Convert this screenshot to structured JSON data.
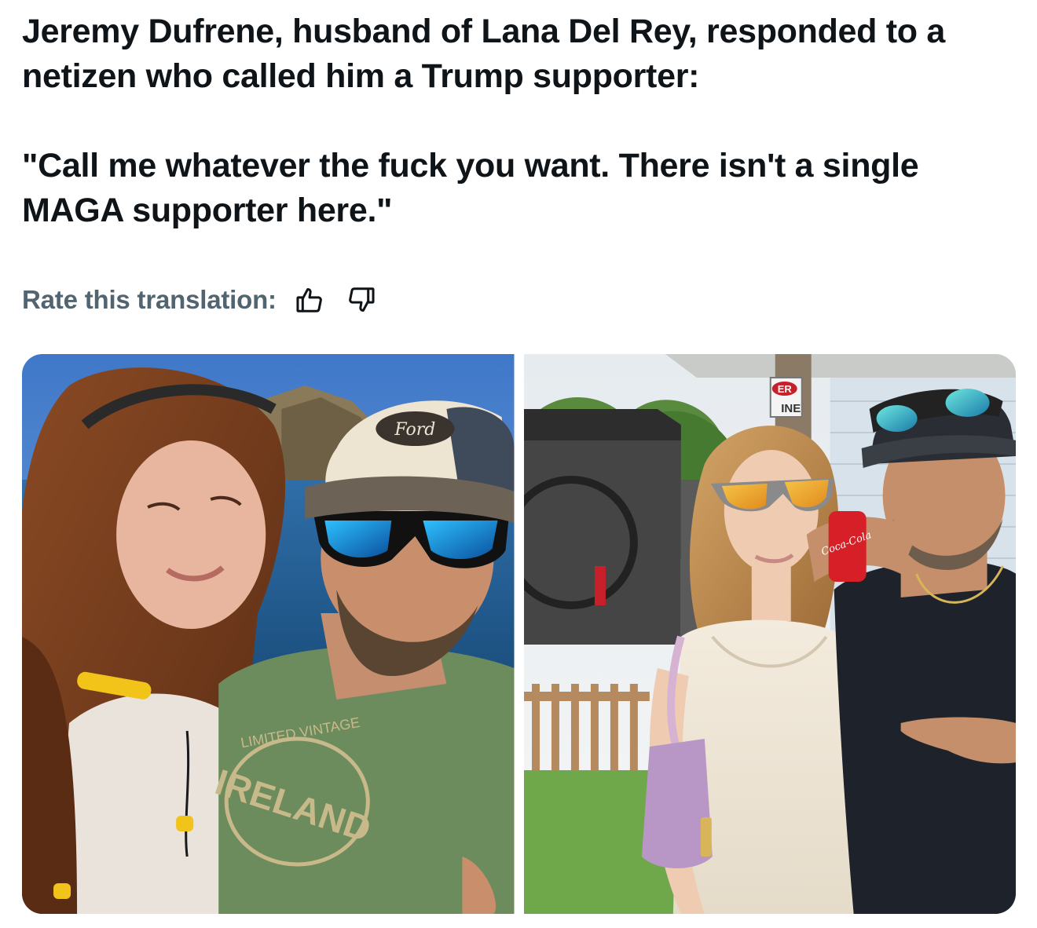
{
  "post": {
    "line_1": "Jeremy Dufrene, husband of Lana Del Rey, responded to a netizen who called him a Trump supporter:",
    "line_2": "\"Call me whatever the fuck you want. There isn't a single MAGA supporter here.\""
  },
  "translation": {
    "rate_label": "Rate this translation:",
    "thumbs_up_icon": "thumbs-up-icon",
    "thumbs_down_icon": "thumbs-down-icon"
  },
  "media": {
    "photo_1": {
      "cap_text": "Ford",
      "shirt_text": "IRELAND",
      "shirt_subtext": "LIMITED VINTAGE"
    },
    "photo_2": {
      "sign_text_1": "ER",
      "sign_text_2": "INE",
      "can_text": "Coca-Cola"
    }
  },
  "colors": {
    "text_primary": "#0f1419",
    "text_secondary": "#536471"
  }
}
